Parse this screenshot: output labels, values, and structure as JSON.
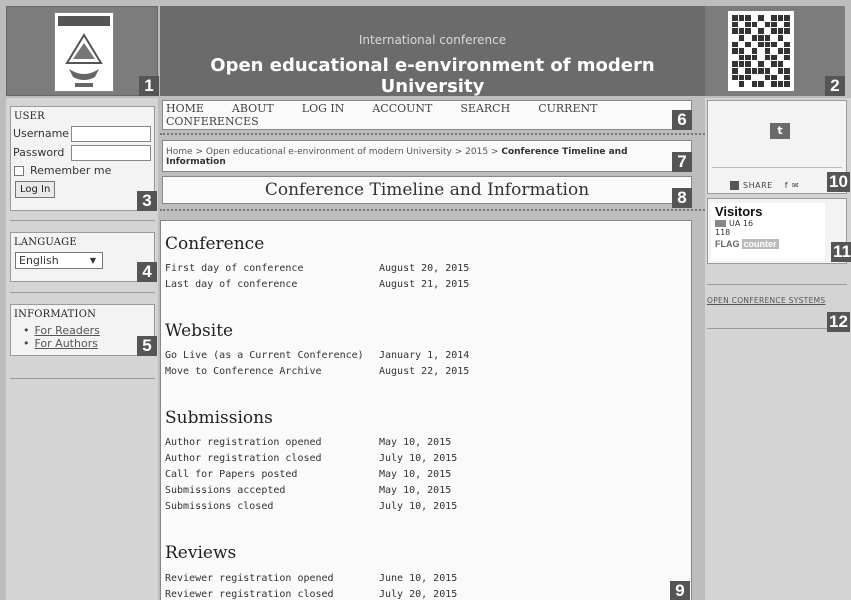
{
  "header": {
    "subtitle": "International conference",
    "title": "Open educational e-environment of modern University"
  },
  "markers": [
    "1",
    "2",
    "3",
    "4",
    "5",
    "6",
    "7",
    "8",
    "9",
    "10",
    "11",
    "12"
  ],
  "user_block": {
    "title": "USER",
    "username_label": "Username",
    "password_label": "Password",
    "remember_label": "Remember me",
    "login_button": "Log In"
  },
  "language_block": {
    "title": "LANGUAGE",
    "selected": "English"
  },
  "information_block": {
    "title": "INFORMATION",
    "links": [
      "For Readers",
      "For Authors"
    ]
  },
  "nav": {
    "items": [
      "HOME",
      "ABOUT",
      "LOG IN",
      "ACCOUNT",
      "SEARCH",
      "CURRENT",
      "CONFERENCES"
    ]
  },
  "breadcrumb": {
    "home": "Home",
    "sep": ">",
    "conference": "Open educational e-environment of modern University",
    "year": "2015",
    "current": "Conference Timeline and Information"
  },
  "page_title": "Conference Timeline and Information",
  "sections": [
    {
      "heading": "Conference",
      "rows": [
        {
          "label": "First day of conference",
          "date": "August 20, 2015"
        },
        {
          "label": "Last day of conference",
          "date": "August 21, 2015"
        }
      ]
    },
    {
      "heading": "Website",
      "rows": [
        {
          "label": "Go Live (as a Current Conference)",
          "date": "January 1, 2014"
        },
        {
          "label": "Move to Conference Archive",
          "date": "August 22, 2015"
        }
      ]
    },
    {
      "heading": "Submissions",
      "rows": [
        {
          "label": "Author registration opened",
          "date": "May 10, 2015"
        },
        {
          "label": "Author registration closed",
          "date": "July 10, 2015"
        },
        {
          "label": "Call for Papers posted",
          "date": "May 10, 2015"
        },
        {
          "label": "Submissions accepted",
          "date": "May 10, 2015"
        },
        {
          "label": "Submissions closed",
          "date": "July 10, 2015"
        }
      ]
    },
    {
      "heading": "Reviews",
      "rows": [
        {
          "label": "Reviewer registration opened",
          "date": "June 10, 2015"
        },
        {
          "label": "Reviewer registration closed",
          "date": "July 20, 2015"
        }
      ]
    }
  ],
  "right": {
    "twitter_icon": "twitter-bird-icon",
    "share_label": "SHARE",
    "visitors_title": "Visitors",
    "visitors_country": "UA",
    "visitors_count_country": "16",
    "visitors_total": "118",
    "flag_counter_flag": "FLAG",
    "flag_counter_counter": "counter",
    "ocs_link": "OPEN CONFERENCE SYSTEMS"
  }
}
